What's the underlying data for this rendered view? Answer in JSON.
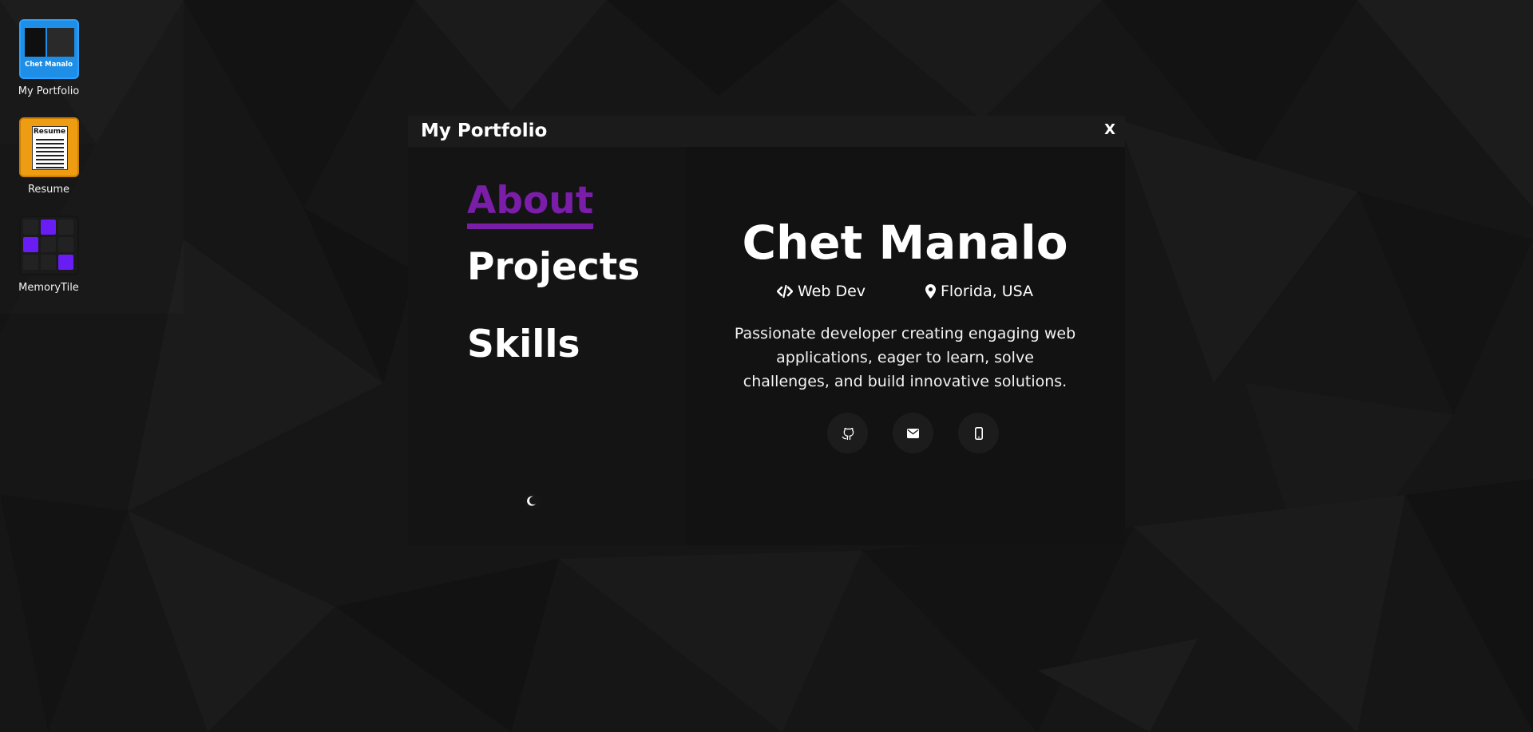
{
  "desktop": {
    "icons": [
      {
        "label": "My Portfolio",
        "thumb_text": "Chet Manalo",
        "icon": "portfolio-thumbnail-icon"
      },
      {
        "label": "Resume",
        "thumb_text": "Resume",
        "icon": "resume-document-icon"
      },
      {
        "label": "MemoryTile",
        "icon": "memory-tile-grid-icon"
      }
    ]
  },
  "window": {
    "title": "My Portfolio",
    "close_label": "X"
  },
  "nav": {
    "items": [
      "About",
      "Projects",
      "Skills"
    ],
    "active": "About",
    "theme_icon": "moon-icon"
  },
  "profile": {
    "name": "Chet Manalo",
    "role": "Web Dev",
    "location": "Florida, USA",
    "bio": "Passionate developer creating engaging web applications, eager to learn, solve challenges, and build innovative solutions.",
    "social_icons": [
      "github-icon",
      "mail-icon",
      "phone-icon"
    ]
  },
  "colors": {
    "accent": "#7a1eaa",
    "background": "#161616",
    "window": "#121212",
    "titlebar": "#1b1b1b",
    "portfolio_tile": "#1e8ee6",
    "resume_tile": "#ee9d12",
    "memory_tile_on": "#6a1cf4"
  }
}
